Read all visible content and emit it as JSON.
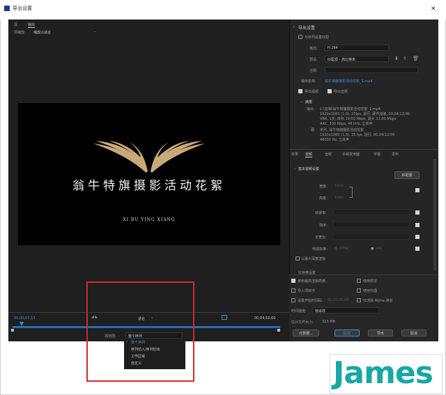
{
  "window": {
    "title": "导出设置",
    "close_icon": "close-icon"
  },
  "left_panel": {
    "tabs": [
      "源",
      "输出"
    ],
    "scale_label": "源缩放:",
    "scale_value": "缩放以适合",
    "video": {
      "title": "翁牛特旗摄影活动花絮",
      "subtitle": "XI BU YING XIANG",
      "logo_color": "#c9a97a"
    },
    "timecode_start": "00;00;07;13",
    "fit_label": "适合",
    "timecode_end": "00;04;12;00",
    "source_range_label": "源范围:",
    "source_range_value": "整个序列",
    "range_options": [
      "整个序列",
      "序列切入/序列切出",
      "工作区域",
      "自定义"
    ],
    "selected_range_index": 0
  },
  "right_panel": {
    "section_title": "导出设置",
    "match_sequence_label": "与序列设置匹配",
    "format_label": "格式:",
    "format_value": "H.264",
    "preset_label": "预设:",
    "preset_value": "匹配源 - 高比特率",
    "comment_label": "注释:",
    "output_name_label": "输出名称:",
    "output_name_value": "翁牛特旗摄影活动花絮_1.mp4",
    "export_video_label": "导出视频",
    "export_audio_label": "导出音频",
    "summary_title": "摘要",
    "output_label": "输出:",
    "output_lines": [
      "C:\\剪辑\\翁牛特旗摄影活动花絮_1.mp4",
      "1920x1080 (1.0), 25fps, 逐行, 硬件加速, 00;04;12;00",
      "VBR, 1次, 目标 10.00 Mbps, 最大 12.00 Mbps",
      "AAC, 320 Kbps, 48 kHz, 立体声"
    ],
    "source_label": "源:",
    "source_lines": [
      "序列, 翁牛特旗摄影活动花絮",
      "1920x1080 (1.0), 25 fps, 逐行, 00;04;12;00",
      "48000 Hz, 立体声"
    ],
    "tabs": [
      "效果",
      "视频",
      "音频",
      "多路复用器",
      "字幕",
      "发布"
    ],
    "active_tab": 1,
    "basic_video_title": "基本视频设置",
    "match_source_button": "匹配源",
    "width_label": "宽度:",
    "width_value": "1920",
    "height_label": "高度:",
    "height_value": "1080",
    "frame_rate_label": "帧速率:",
    "field_order_label": "场序:",
    "aspect_label": "长宽比:",
    "tv_standard_label": "电视标准:",
    "ntsc_label": "NTSC",
    "pal_label": "PAL",
    "max_depth_label": "以最大深度渲染",
    "bitrate_title": "比特率设置",
    "max_quality_label": "使用最高渲染质量",
    "use_preview_label": "使用预览",
    "import_project_label": "导入项目中",
    "use_proxy_label": "使用代理",
    "set_start_tc_label": "设置开始时间码",
    "start_tc_value": "00;00;00;00",
    "alpha_label": "仅渲染 Alpha 通道",
    "interp_label": "时间插值:",
    "interp_value": "帧采样",
    "file_size_label": "估计文件大小:",
    "file_size_value": "323 MB",
    "metadata_button": "元数据...",
    "queue_button": "队列",
    "export_button": "导出",
    "cancel_button": "取消"
  },
  "watermark": {
    "text": "James"
  }
}
